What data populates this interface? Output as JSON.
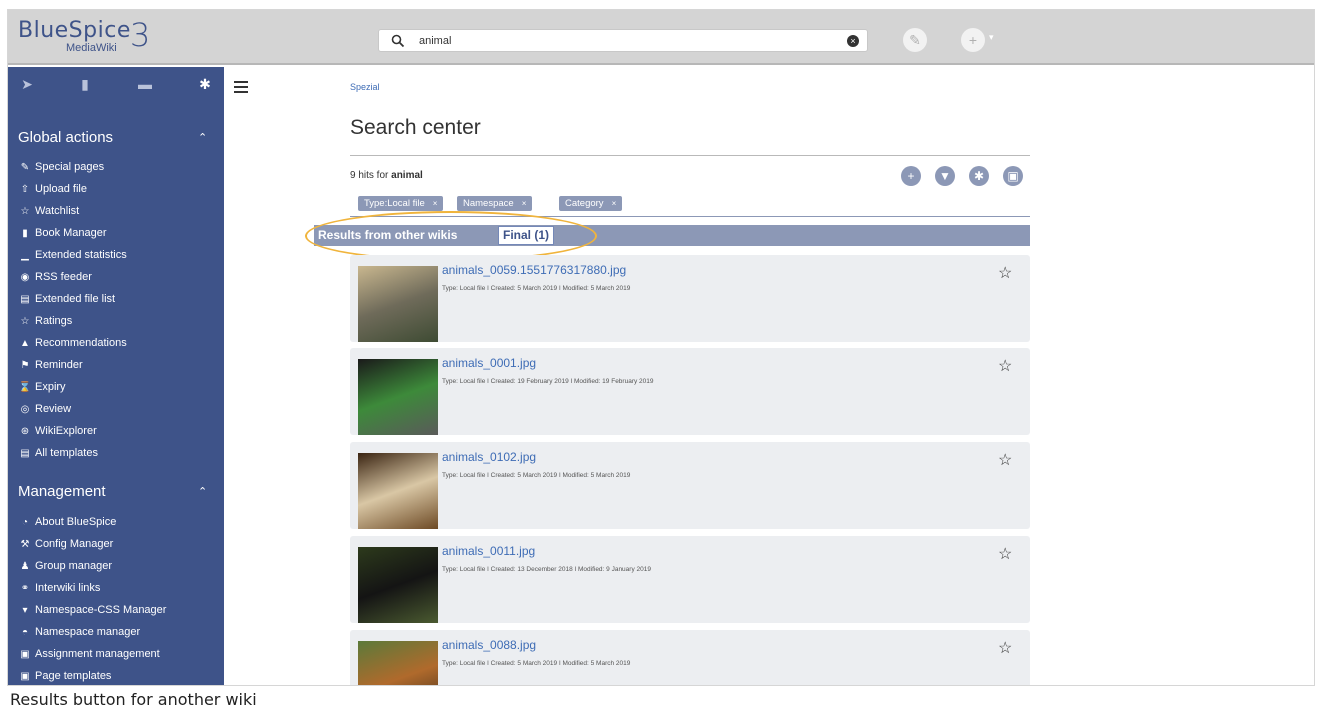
{
  "header": {
    "logo_text": "BlueSpice",
    "logo_sub": "MediaWiki",
    "logo_version": "3",
    "search_value": "animal",
    "search_clear_glyph": "×",
    "edit_glyph": "✎",
    "add_glyph": "+",
    "caret_glyph": "▾"
  },
  "sidebar": {
    "tab_glyphs": [
      "➤",
      "▮",
      "▬",
      "✱"
    ],
    "sections": [
      {
        "title": "Global actions",
        "caret": "⌃",
        "items": [
          {
            "icon": "✎",
            "label": "Special pages"
          },
          {
            "icon": "⇧",
            "label": "Upload file"
          },
          {
            "icon": "☆",
            "label": "Watchlist"
          },
          {
            "icon": "▮",
            "label": "Book Manager"
          },
          {
            "icon": "▁",
            "label": "Extended statistics"
          },
          {
            "icon": "◉",
            "label": "RSS feeder"
          },
          {
            "icon": "▤",
            "label": "Extended file list"
          },
          {
            "icon": "☆",
            "label": "Ratings"
          },
          {
            "icon": "▲",
            "label": "Recommendations"
          },
          {
            "icon": "⚑",
            "label": "Reminder"
          },
          {
            "icon": "⌛",
            "label": "Expiry"
          },
          {
            "icon": "◎",
            "label": "Review"
          },
          {
            "icon": "⊛",
            "label": "WikiExplorer"
          },
          {
            "icon": "▤",
            "label": "All templates"
          }
        ]
      },
      {
        "title": "Management",
        "caret": "⌃",
        "items": [
          {
            "icon": "◔",
            "label": "About BlueSpice"
          },
          {
            "icon": "⚒",
            "label": "Config Manager"
          },
          {
            "icon": "♟",
            "label": "Group manager"
          },
          {
            "icon": "⚭",
            "label": "Interwiki links"
          },
          {
            "icon": "▾",
            "label": "Namespace-CSS Manager"
          },
          {
            "icon": "◓",
            "label": "Namespace manager"
          },
          {
            "icon": "▣",
            "label": "Assignment management"
          },
          {
            "icon": "▣",
            "label": "Page templates"
          }
        ]
      }
    ]
  },
  "main": {
    "breadcrumb": "Spezial",
    "title": "Search center",
    "hits_prefix": "9 hits for",
    "hits_term": "animal",
    "actions": [
      "+",
      "▼",
      "✱",
      "▣"
    ],
    "filters": [
      {
        "label": "Type:Local file",
        "x": "×"
      },
      {
        "label": "Namespace",
        "x": "×"
      },
      {
        "label": "Category",
        "x": "×"
      }
    ],
    "results_label": "Results from other wikis",
    "results_button": "Final (1)",
    "results": [
      {
        "name": "animals_0059.1551776317880.jpg",
        "meta": "Type: Local file ǀ Created: 5 March 2019 ǀ Modified: 5 March 2019",
        "colors": [
          "#c9b78f",
          "#6f6b5a",
          "#3e4b33"
        ]
      },
      {
        "name": "animals_0001.jpg",
        "meta": "Type: Local file ǀ Created: 19 February 2019 ǀ Modified: 19 February 2019",
        "colors": [
          "#1a1a1a",
          "#3d8a3a",
          "#5a5a5a"
        ]
      },
      {
        "name": "animals_0102.jpg",
        "meta": "Type: Local file ǀ Created: 5 March 2019 ǀ Modified: 5 March 2019",
        "colors": [
          "#3a2412",
          "#d9c7a5",
          "#6d4a25"
        ]
      },
      {
        "name": "animals_0011.jpg",
        "meta": "Type: Local file ǀ Created: 13 December 2018 ǀ Modified: 9 January 2019",
        "colors": [
          "#2d3a1c",
          "#141414",
          "#4a5a30"
        ]
      },
      {
        "name": "animals_0088.jpg",
        "meta": "Type: Local file ǀ Created: 5 March 2019 ǀ Modified: 5 March 2019",
        "colors": [
          "#5b7a3a",
          "#b06a2c",
          "#3b2a1a"
        ]
      }
    ],
    "star_glyph": "☆"
  },
  "caption": "Results button for another wiki"
}
